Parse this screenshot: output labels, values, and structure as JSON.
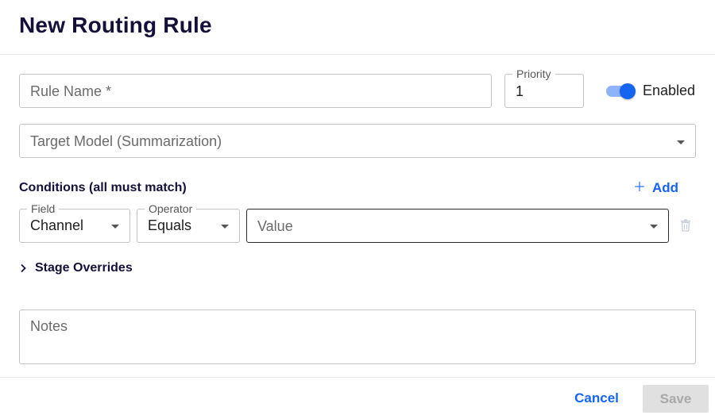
{
  "dialog": {
    "title": "New Routing Rule"
  },
  "form": {
    "rule_name": {
      "placeholder": "Rule Name *",
      "value": ""
    },
    "priority": {
      "label": "Priority",
      "value": "1"
    },
    "enabled": {
      "label": "Enabled",
      "checked": true
    },
    "target_model": {
      "placeholder": "Target Model (Summarization)",
      "value": ""
    },
    "conditions": {
      "label": "Conditions (all must match)",
      "add_label": "Add",
      "rows": [
        {
          "field": {
            "label": "Field",
            "value": "Channel"
          },
          "operator": {
            "label": "Operator",
            "value": "Equals"
          },
          "value": {
            "placeholder": "Value",
            "value": ""
          }
        }
      ]
    },
    "stage_overrides": {
      "label": "Stage Overrides",
      "expanded": false
    },
    "notes": {
      "placeholder": "Notes",
      "value": ""
    }
  },
  "footer": {
    "cancel_label": "Cancel",
    "save_label": "Save",
    "save_disabled": true
  },
  "colors": {
    "accent": "#1565f0",
    "title": "#14103a",
    "disabled_bg": "#e0e0e0",
    "disabled_text": "#a9a9a9"
  },
  "icons": [
    "chevron-down-icon",
    "plus-icon",
    "trash-icon",
    "chevron-right-icon"
  ]
}
